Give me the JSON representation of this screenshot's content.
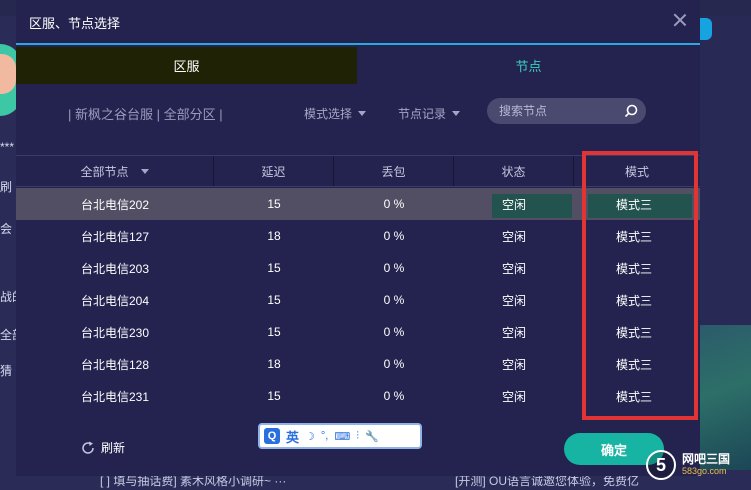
{
  "dialog": {
    "title": "区服、节点选择",
    "tabs": {
      "server": "区服",
      "node": "节点"
    },
    "breadcrumb": "| 新枫之谷台服 | 全部分区 |",
    "filters": {
      "mode_select": "模式选择",
      "node_history": "节点记录"
    },
    "search": {
      "placeholder": "搜索节点"
    },
    "table": {
      "headers": {
        "node": "全部节点",
        "latency": "延迟",
        "loss": "丢包",
        "status": "状态",
        "mode": "模式"
      },
      "rows": [
        {
          "node": "台北电信202",
          "latency": "15",
          "loss": "0 %",
          "status": "空闲",
          "mode": "模式三"
        },
        {
          "node": "台北电信127",
          "latency": "18",
          "loss": "0 %",
          "status": "空闲",
          "mode": "模式三"
        },
        {
          "node": "台北电信203",
          "latency": "15",
          "loss": "0 %",
          "status": "空闲",
          "mode": "模式三"
        },
        {
          "node": "台北电信204",
          "latency": "15",
          "loss": "0 %",
          "status": "空闲",
          "mode": "模式三"
        },
        {
          "node": "台北电信230",
          "latency": "15",
          "loss": "0 %",
          "status": "空闲",
          "mode": "模式三"
        },
        {
          "node": "台北电信128",
          "latency": "18",
          "loss": "0 %",
          "status": "空闲",
          "mode": "模式三"
        },
        {
          "node": "台北电信231",
          "latency": "15",
          "loss": "0 %",
          "status": "空闲",
          "mode": "模式三"
        }
      ]
    },
    "refresh_label": "刷新",
    "confirm_label": "确定"
  },
  "ime": {
    "logo": "Q",
    "lang": "英"
  },
  "watermark": {
    "logo": "5",
    "name": "网吧三国",
    "url": "583go.com"
  },
  "background": {
    "left_texts": [
      "***",
      "刷",
      "会",
      "战的",
      "全部",
      "猜"
    ],
    "bottom_left": "[ ] 填与抽话费] 素木风格小调研~ ···",
    "bottom_right": "[开测] OU语言诚邀您体验，免费亿"
  },
  "colors": {
    "accent_teal": "#17b3a3",
    "tab_active": "#39d0c0",
    "highlight_red": "#e13535",
    "selected_row": "#524f64"
  }
}
